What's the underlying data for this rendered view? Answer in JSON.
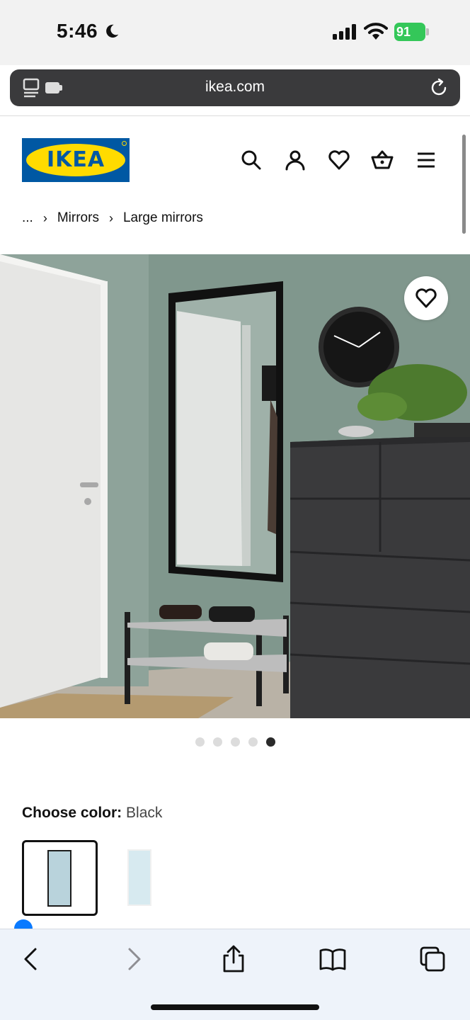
{
  "status_bar": {
    "time": "5:46",
    "battery": "91",
    "icons": [
      "moon-icon",
      "cellular-signal-icon",
      "wifi-icon",
      "battery-charging-icon"
    ]
  },
  "browser": {
    "url": "ikea.com",
    "left_icon": "page-menu-icon",
    "reload_icon": "reload-icon"
  },
  "header": {
    "logo_text": "IKEA",
    "brand_blue": "#0058a3",
    "brand_yellow": "#ffdb00",
    "icons": [
      "search-icon",
      "account-icon",
      "favourites-icon",
      "cart-icon",
      "menu-icon"
    ]
  },
  "breadcrumb": {
    "ellipsis": "...",
    "items": [
      "Mirrors",
      "Large mirrors"
    ]
  },
  "gallery": {
    "image_count": 5,
    "active_index": 4
  },
  "color_chooser": {
    "label": "Choose color:",
    "selected_value": "Black",
    "options": [
      "black",
      "white"
    ]
  },
  "toolbar": {
    "icons": [
      "back-icon",
      "forward-icon",
      "share-icon",
      "bookmarks-icon",
      "tabs-icon"
    ]
  }
}
